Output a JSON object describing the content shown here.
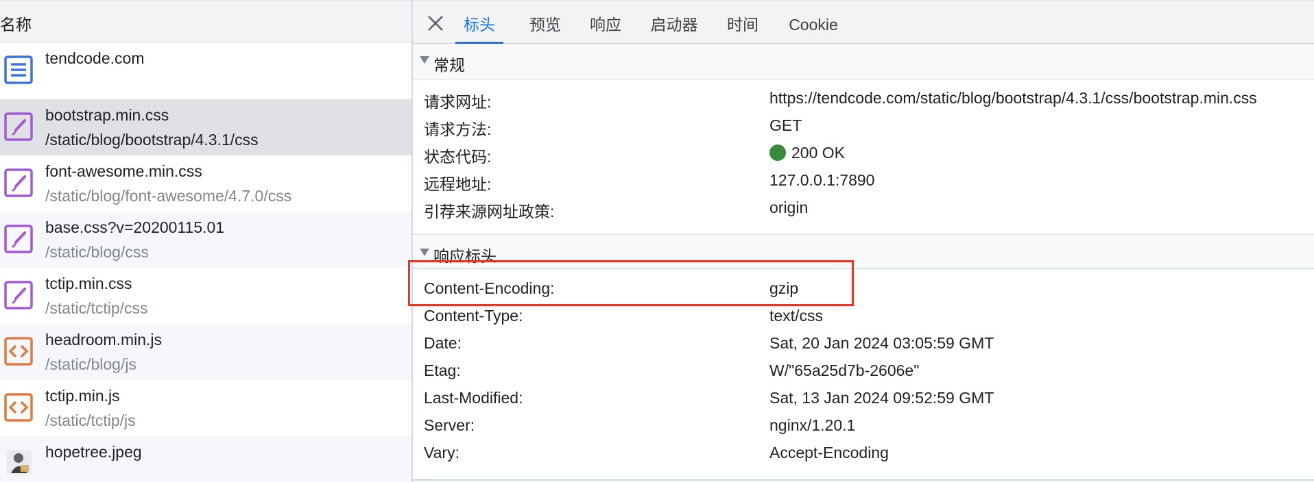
{
  "list": {
    "header": "名称",
    "rows": [
      {
        "name": "tendcode.com",
        "path": "",
        "type": "document"
      },
      {
        "name": "bootstrap.min.css",
        "path": "/static/blog/bootstrap/4.3.1/css",
        "type": "stylesheet",
        "selected": true
      },
      {
        "name": "font-awesome.min.css",
        "path": "/static/blog/font-awesome/4.7.0/css",
        "type": "stylesheet"
      },
      {
        "name": "base.css?v=20200115.01",
        "path": "/static/blog/css",
        "type": "stylesheet"
      },
      {
        "name": "tctip.min.css",
        "path": "/static/tctip/css",
        "type": "stylesheet"
      },
      {
        "name": "headroom.min.js",
        "path": "/static/blog/js",
        "type": "script"
      },
      {
        "name": "tctip.min.js",
        "path": "/static/tctip/js",
        "type": "script"
      },
      {
        "name": "hopetree.jpeg",
        "path": "",
        "type": "image"
      }
    ]
  },
  "tabs": [
    "标头",
    "预览",
    "响应",
    "启动器",
    "时间",
    "Cookie"
  ],
  "active_tab": "标头",
  "general": {
    "title": "常规",
    "rows": [
      {
        "key": "请求网址:",
        "value": "https://tendcode.com/static/blog/bootstrap/4.3.1/css/bootstrap.min.css"
      },
      {
        "key": "请求方法:",
        "value": "GET"
      },
      {
        "key": "状态代码:",
        "value": "200 OK"
      },
      {
        "key": "远程地址:",
        "value": "127.0.0.1:7890"
      },
      {
        "key": "引荐来源网址政策:",
        "value": "origin"
      }
    ]
  },
  "response_headers": {
    "title": "响应标头",
    "rows": [
      {
        "key": "Content-Encoding:",
        "value": "gzip",
        "highlighted": true
      },
      {
        "key": "Content-Type:",
        "value": "text/css"
      },
      {
        "key": "Date:",
        "value": "Sat, 20 Jan 2024 03:05:59 GMT"
      },
      {
        "key": "Etag:",
        "value": "W/\"65a25d7b-2606e\""
      },
      {
        "key": "Last-Modified:",
        "value": "Sat, 13 Jan 2024 09:52:59 GMT"
      },
      {
        "key": "Server:",
        "value": "nginx/1.20.1"
      },
      {
        "key": "Vary:",
        "value": "Accept-Encoding"
      }
    ]
  },
  "colors": {
    "accent": "#1a73e8",
    "status_ok": "#3a8a3e",
    "highlight": "#e0392b",
    "stylesheet_icon": "#a259d9",
    "script_icon": "#e07a3f",
    "document_icon": "#3f73e0"
  },
  "icons": {
    "document": "document-icon",
    "stylesheet": "stylesheet-icon",
    "script": "script-icon",
    "image": "image-thumbnail-icon",
    "close": "close-icon",
    "section_toggle": "triangle-down-icon",
    "status": "status-dot-icon"
  }
}
